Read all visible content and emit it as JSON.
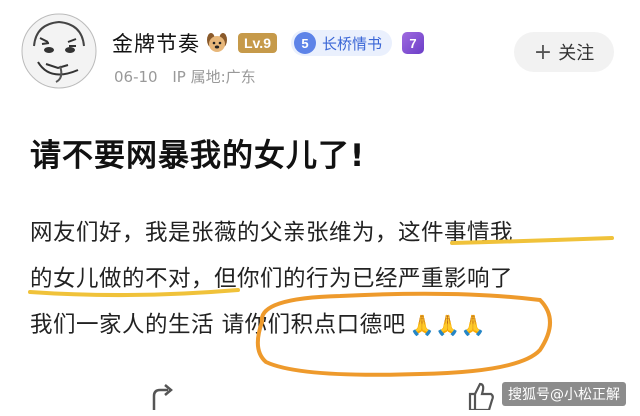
{
  "post": {
    "author": {
      "name": "金牌节奏",
      "level": "Lv.9",
      "fan_badge_number": "5",
      "fan_badge_label": "长桥情书",
      "extra_badge": "7",
      "date": "06-10",
      "ip_location": "IP 属地:广东"
    },
    "follow_label": "关注",
    "title": "请不要网暴我的女儿了!",
    "body_lines": [
      "网友们好，我是张薇的父亲张维为，这件事情我",
      "的女儿做的不对，但你们的行为已经严重影响了",
      "我们一家人的生活   请你们积点口德吧"
    ],
    "prayer_emoji": "🙏🙏🙏"
  },
  "watermark": "搜狐号@小松正解",
  "colors": {
    "highlight_underline": "#f0c23a",
    "circle_annotation": "#ee9a2c"
  },
  "icons": [
    "avatar-meme-face",
    "dog-icon",
    "share-icon",
    "thumbs-up-icon"
  ]
}
